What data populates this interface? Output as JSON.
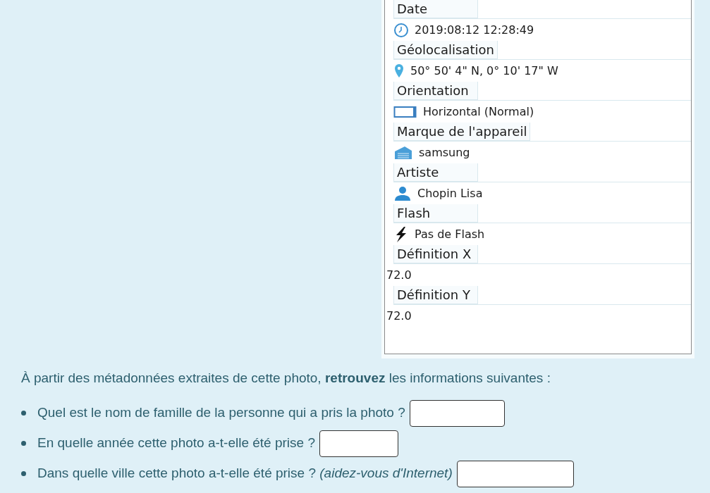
{
  "metadata_panel": {
    "fields": [
      {
        "label": "Date",
        "value": "2019:08:12 12:28:49",
        "kind": "clock"
      },
      {
        "label": "Géolocalisation",
        "value": "50° 50' 4\" N, 0° 10' 17\" W",
        "kind": "pin"
      },
      {
        "label": "Orientation",
        "value": "Horizontal (Normal)",
        "kind": "frame"
      },
      {
        "label": "Marque de l'appareil",
        "value": "samsung",
        "kind": "building"
      },
      {
        "label": "Artiste",
        "value": "Chopin Lisa",
        "kind": "person"
      },
      {
        "label": "Flash",
        "value": "Pas de Flash",
        "kind": "bolt"
      },
      {
        "label": "Définition X",
        "value": "72.0",
        "kind": "plain"
      },
      {
        "label": "Définition Y",
        "value": "72.0",
        "kind": "plain"
      }
    ]
  },
  "instructions": "À partir des métadonnées extraites de cette photo, **retrouvez** les informations suivantes :",
  "questions": [
    {
      "text": "Quel est le nom de famille de la personne qui a pris la photo ?"
    },
    {
      "text": "En quelle année cette photo a-t-elle été prise ?"
    },
    {
      "text": "Dans quelle ville cette photo a-t-elle été prise ? *(aidez-vous d'Internet)*"
    }
  ]
}
